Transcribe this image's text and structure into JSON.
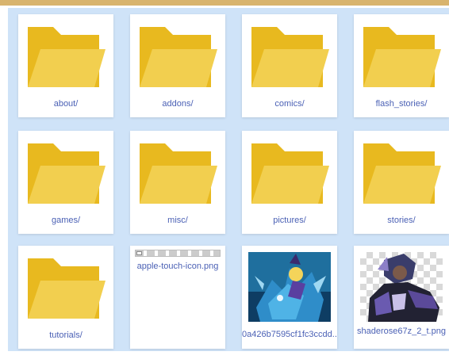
{
  "colors": {
    "background": "#cfe3f8",
    "label": "#4b61b5",
    "folder_back": "#e8b91f",
    "folder_front": "#f2cf4f",
    "accent_bar": "#d8b46e"
  },
  "items": [
    {
      "label": "about/",
      "type": "folder",
      "icon": "folder-icon"
    },
    {
      "label": "addons/",
      "type": "folder",
      "icon": "folder-icon"
    },
    {
      "label": "comics/",
      "type": "folder",
      "icon": "folder-icon"
    },
    {
      "label": "flash_stories/",
      "type": "folder",
      "icon": "folder-icon"
    },
    {
      "label": "games/",
      "type": "folder",
      "icon": "folder-icon"
    },
    {
      "label": "misc/",
      "type": "folder",
      "icon": "folder-icon"
    },
    {
      "label": "pictures/",
      "type": "folder",
      "icon": "folder-icon"
    },
    {
      "label": "stories/",
      "type": "folder",
      "icon": "folder-icon"
    },
    {
      "label": "tutorials/",
      "type": "folder",
      "icon": "folder-icon"
    },
    {
      "label": "apple-touch-icon.png",
      "type": "image",
      "icon": "broken-image-icon"
    },
    {
      "label": "0a426b7595cf1fc3ccdd...",
      "type": "image",
      "icon": "dragon-rider-thumbnail"
    },
    {
      "label": "shaderose67z_2_t.png",
      "type": "image",
      "icon": "armored-figure-thumbnail"
    }
  ]
}
